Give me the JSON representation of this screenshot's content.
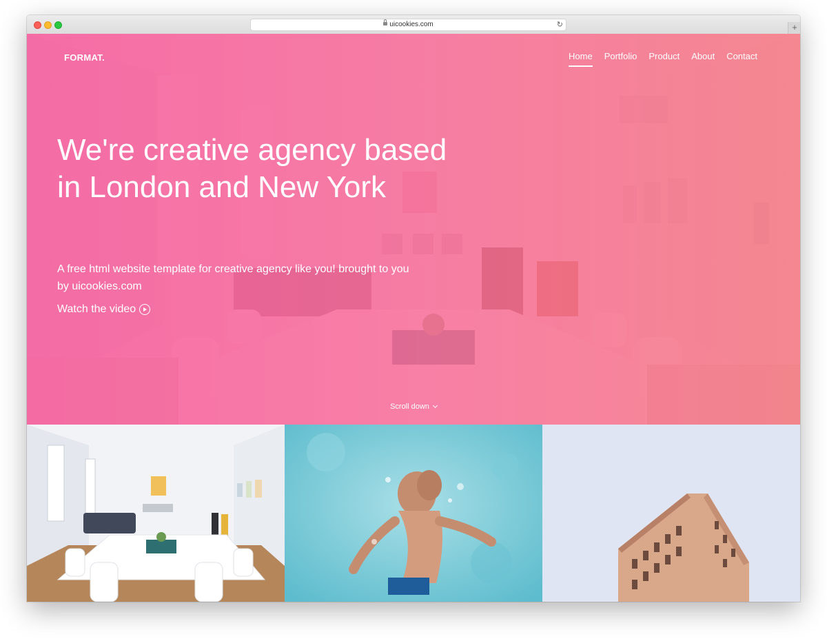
{
  "browser": {
    "url": "uicookies.com",
    "new_tab_symbol": "+",
    "reload_symbol": "↻"
  },
  "site": {
    "logo": "FORMAT.",
    "nav": [
      {
        "label": "Home",
        "active": true
      },
      {
        "label": "Portfolio",
        "active": false
      },
      {
        "label": "Product",
        "active": false
      },
      {
        "label": "About",
        "active": false
      },
      {
        "label": "Contact",
        "active": false
      }
    ]
  },
  "hero": {
    "headline": "We're creative agency based in London and New York",
    "subtitle": "A free html website template for creative agency like you! brought to you by uicookies.com",
    "watch_label": "Watch the video",
    "scroll_label": "Scroll down",
    "gradient": [
      "#f65c9d",
      "#f7688f",
      "#f57882"
    ]
  },
  "gallery": {
    "tiles": [
      {
        "subject": "office-room-image"
      },
      {
        "subject": "swimmer-image"
      },
      {
        "subject": "building-image"
      }
    ]
  }
}
